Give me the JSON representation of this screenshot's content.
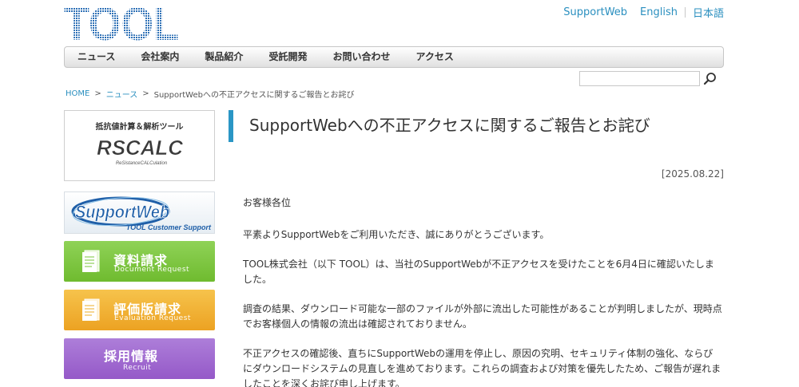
{
  "brand": {
    "logo_text": "TOOL"
  },
  "top_links": [
    {
      "label": "SupportWeb"
    },
    {
      "label": "English"
    },
    {
      "label": "日本語"
    }
  ],
  "nav": {
    "items": [
      "ニュース",
      "会社案内",
      "製品紹介",
      "受託開発",
      "お問い合わせ",
      "アクセス"
    ]
  },
  "search": {
    "value": "",
    "placeholder": ""
  },
  "breadcrumb": {
    "home": "HOME",
    "sep": ">",
    "news": "ニュース",
    "current": "SupportWebへの不正アクセスに関するご報告とお詫び"
  },
  "sidebar": {
    "rscalc": {
      "caption": "抵抗値計算＆解析ツール",
      "logo_text": "RSCALC",
      "logo_sub": "ReSistanceCALCulation"
    },
    "supportweb": {
      "logo_text": "SupportWeb",
      "tagline": "TOOL Customer Support"
    },
    "banners": [
      {
        "title": "資料請求",
        "subtitle": "Document Request",
        "color": "#7cc63f"
      },
      {
        "title": "評価版請求",
        "subtitle": "Evaluation Request",
        "color": "#f0b02e"
      },
      {
        "title": "採用情報",
        "subtitle": "Recruit",
        "color": "#a06cd0"
      }
    ]
  },
  "article": {
    "title": "SupportWebへの不正アクセスに関するご報告とお詫び",
    "date": "[2025.08.22]",
    "paragraphs": [
      "お客様各位",
      "平素よりSupportWebをご利用いただき、誠にありがとうございます。",
      "TOOL株式会社（以下 TOOL）は、当社のSupportWebが不正アクセスを受けたことを6月4日に確認いたしました。",
      "調査の結果、ダウンロード可能な一部のファイルが外部に流出した可能性があることが判明しましたが、現時点でお客様個人の情報の流出は確認されておりません。",
      "不正アクセスの確認後、直ちにSupportWebの運用を停止し、原因の究明、セキュリティ体制の強化、ならびにダウンロードシステムの見直しを進めております。これらの調査および対策を優先したため、ご報告が遅れましたことを深くお詫び申し上げます。"
    ]
  },
  "colors": {
    "accent": "#2a96c5",
    "link": "#2a8fbf",
    "logo_blue": "#2c6fb5"
  }
}
